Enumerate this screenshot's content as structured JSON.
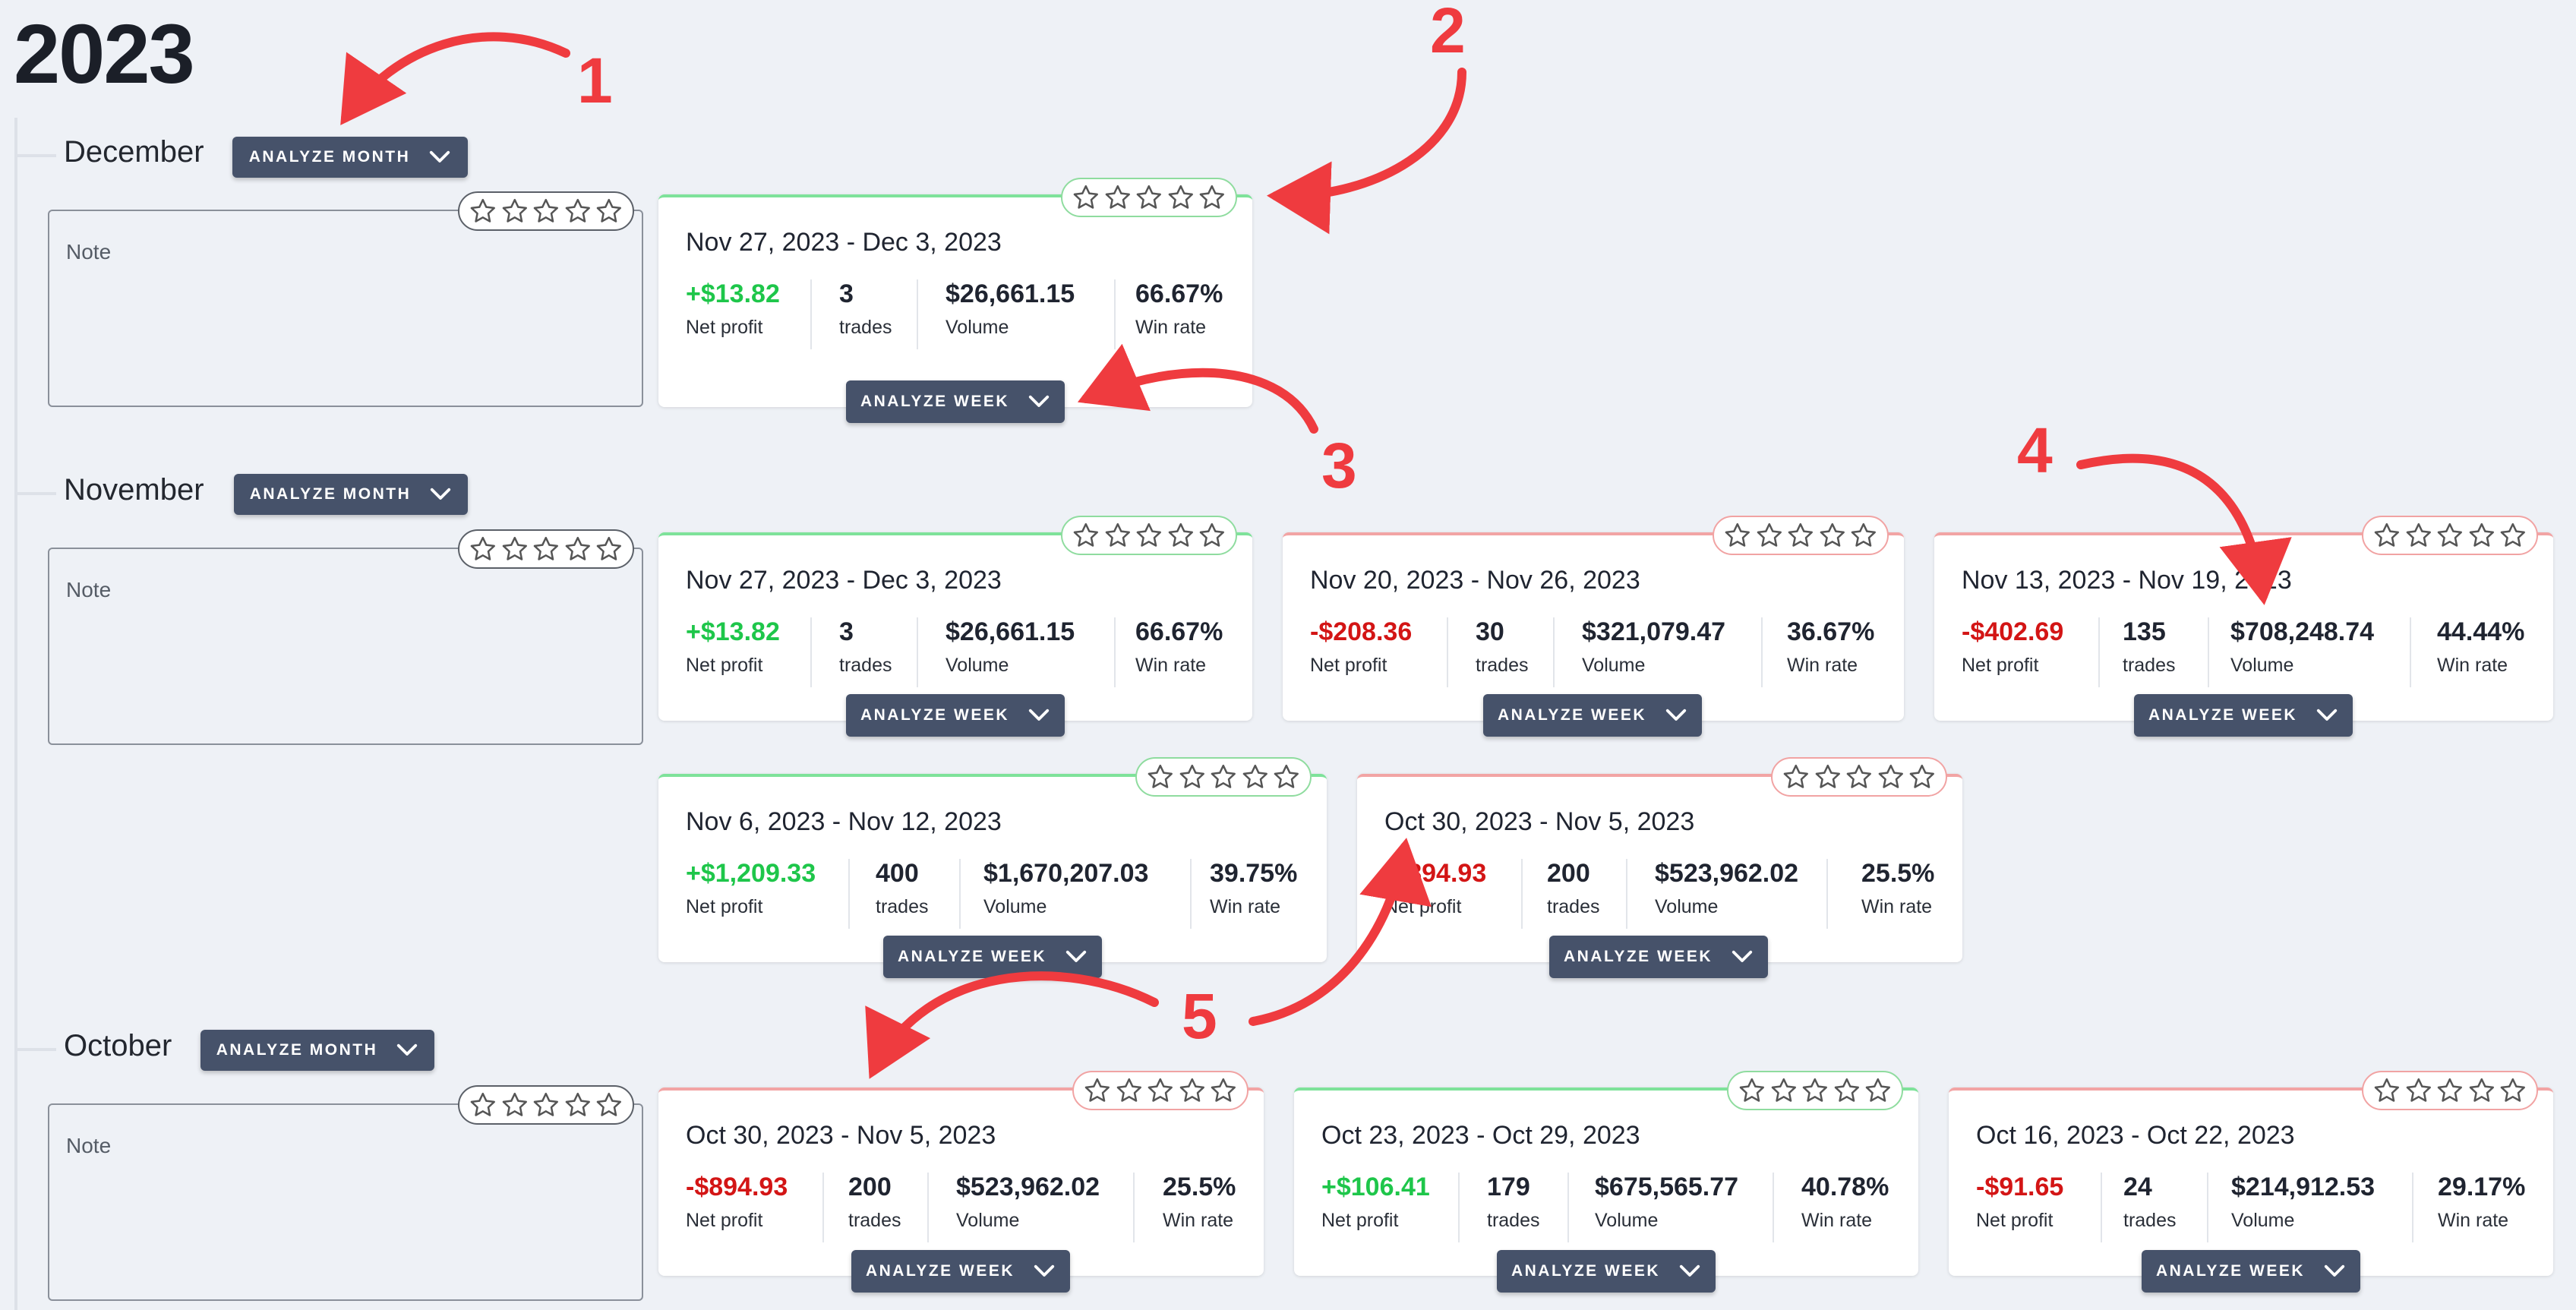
{
  "year": "2023",
  "months": [
    {
      "name": "December",
      "button": "ANALYZE MONTH",
      "note_placeholder": "Note"
    },
    {
      "name": "November",
      "button": "ANALYZE MONTH",
      "note_placeholder": "Note"
    },
    {
      "name": "October",
      "button": "ANALYZE MONTH",
      "note_placeholder": "Note"
    }
  ],
  "weeks": [
    {
      "range": "Nov 27, 2023 - Dec 3, 2023",
      "net_profit": "+$13.82",
      "trades": "3",
      "volume": "$26,661.15",
      "win_rate": "66.67%",
      "status": "positive"
    },
    {
      "range": "Nov 27, 2023 - Dec 3, 2023",
      "net_profit": "+$13.82",
      "trades": "3",
      "volume": "$26,661.15",
      "win_rate": "66.67%",
      "status": "positive"
    },
    {
      "range": "Nov 20, 2023 - Nov 26, 2023",
      "net_profit": "-$208.36",
      "trades": "30",
      "volume": "$321,079.47",
      "win_rate": "36.67%",
      "status": "negative"
    },
    {
      "range": "Nov 13, 2023 - Nov 19, 2023",
      "net_profit": "-$402.69",
      "trades": "135",
      "volume": "$708,248.74",
      "win_rate": "44.44%",
      "status": "negative"
    },
    {
      "range": "Nov 6, 2023 - Nov 12, 2023",
      "net_profit": "+$1,209.33",
      "trades": "400",
      "volume": "$1,670,207.03",
      "win_rate": "39.75%",
      "status": "positive"
    },
    {
      "range": "Oct 30, 2023 - Nov 5, 2023",
      "net_profit": "-$894.93",
      "trades": "200",
      "volume": "$523,962.02",
      "win_rate": "25.5%",
      "status": "negative"
    },
    {
      "range": "Oct 30, 2023 - Nov 5, 2023",
      "net_profit": "-$894.93",
      "trades": "200",
      "volume": "$523,962.02",
      "win_rate": "25.5%",
      "status": "negative"
    },
    {
      "range": "Oct 23, 2023 - Oct 29, 2023",
      "net_profit": "+$106.41",
      "trades": "179",
      "volume": "$675,565.77",
      "win_rate": "40.78%",
      "status": "positive"
    },
    {
      "range": "Oct 16, 2023 - Oct 22, 2023",
      "net_profit": "-$91.65",
      "trades": "24",
      "volume": "$214,912.53",
      "win_rate": "29.17%",
      "status": "negative"
    }
  ],
  "labels": {
    "net_profit": "Net profit",
    "trades": "trades",
    "volume": "Volume",
    "win_rate": "Win rate",
    "analyze_week": "ANALYZE WEEK"
  },
  "annotations": [
    "1",
    "2",
    "3",
    "4",
    "5"
  ],
  "colors": {
    "positive": "#1ec64a",
    "negative": "#d31515",
    "button_bg": "#46526a",
    "annotation": "#ef3b3f"
  }
}
